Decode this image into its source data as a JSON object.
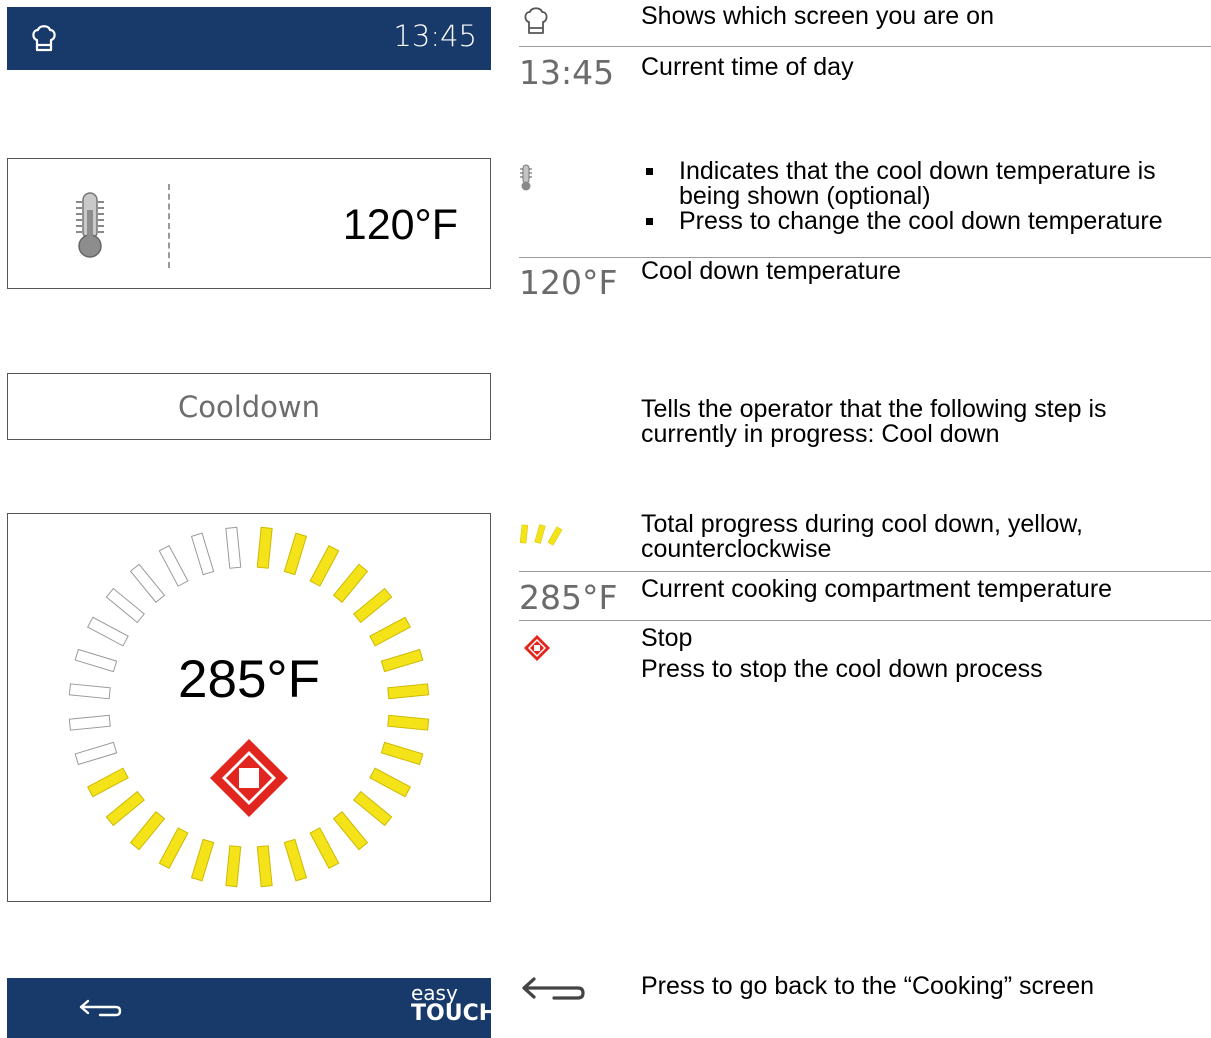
{
  "header": {
    "screen_icon": "chef-hat-icon",
    "time": "13:45"
  },
  "cooldown_temp_panel": {
    "icon": "thermometer-icon",
    "value": "120°F"
  },
  "step_banner": {
    "label": "Cooldown"
  },
  "progress_dial": {
    "temperature": "285°F",
    "stop_icon": "stop-diamond-icon",
    "progress_fraction": 0.7,
    "segments": 32,
    "colors": {
      "done": "#f5e31a",
      "pending": "#ffffff",
      "outline": "#9a9a9a",
      "stop": "#e0261f"
    }
  },
  "footer": {
    "back_icon": "back-arrow-icon",
    "logo_top": "easy",
    "logo_bottom": "TOUCH"
  },
  "legend": {
    "screen_desc": "Shows which screen you are on",
    "time_icon_text": "13:45",
    "time_desc": "Current time of day",
    "thermo_bullets": [
      "Indicates that the cool down temperature is being shown (optional)",
      "Press to change the cool down temperature"
    ],
    "cooldown_icon_text": "120°F",
    "cooldown_desc": "Cool down temperature",
    "step_desc": "Tells the operator that the following step is currently in progress: Cool down",
    "progress_desc": "Total progress during cool down, yellow, counterclockwise",
    "compartment_icon_text": "285°F",
    "compartment_desc": "Current cooking compartment temperature",
    "stop_title": "Stop",
    "stop_desc": "Press to stop the cool down process",
    "back_desc": "Press to go back to the “Cooking” screen"
  },
  "colors": {
    "navy": "#173a6b",
    "rule": "#9b9b9b"
  }
}
